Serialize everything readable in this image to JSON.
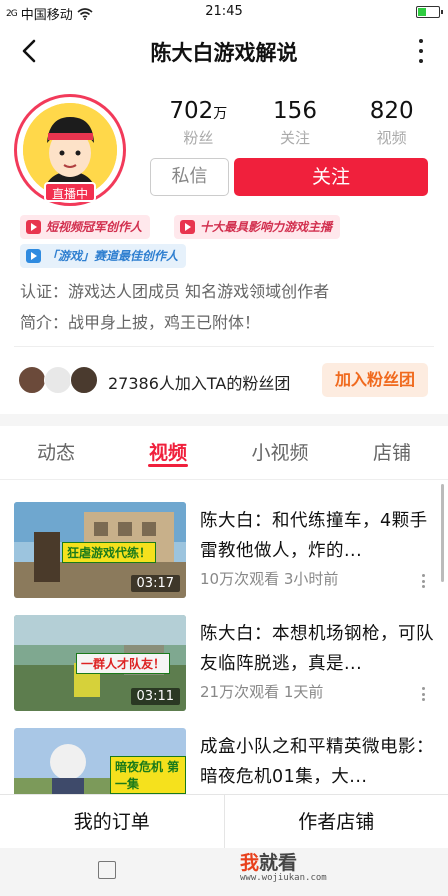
{
  "status_bar": {
    "signal": "2G",
    "carrier": "中国移动",
    "time": "21:45"
  },
  "nav": {
    "title": "陈大白游戏解说"
  },
  "profile": {
    "live_badge": "直播中",
    "stats": [
      {
        "value": "702",
        "unit": "万",
        "label": "粉丝"
      },
      {
        "value": "156",
        "unit": "",
        "label": "关注"
      },
      {
        "value": "820",
        "unit": "",
        "label": "视频"
      }
    ],
    "message_button": "私信",
    "follow_button": "关注",
    "tags": [
      "短视频冠军创作人",
      "十大最具影响力游戏主播",
      "「游戏」赛道最佳创作人"
    ],
    "certification": "认证：游戏达人团成员 知名游戏领域创作者",
    "bio": "简介：战甲身上披，鸡王已附体！"
  },
  "fan_club": {
    "text": "27386人加入TA的粉丝团",
    "join_button": "加入粉丝团"
  },
  "tabs": [
    {
      "label": "动态",
      "active": false
    },
    {
      "label": "视频",
      "active": true
    },
    {
      "label": "小视频",
      "active": false
    },
    {
      "label": "店铺",
      "active": false
    }
  ],
  "videos": [
    {
      "title": "陈大白：和代练撞车，4颗手雷教他做人，炸的...",
      "meta": "10万次观看 3小时前",
      "duration": "03:17",
      "thumb_caption": "狂虐游戏代练！"
    },
    {
      "title": "陈大白：本想机场钢枪，可队友临阵脱逃，真是...",
      "meta": "21万次观看 1天前",
      "duration": "03:11",
      "thumb_caption": "一群人才队友！"
    },
    {
      "title": "成盒小队之和平精英微电影：暗夜危机01集，大...",
      "meta": "",
      "duration": "",
      "thumb_caption": "暗夜危机 第一集"
    }
  ],
  "bottom_bar": {
    "orders": "我的订单",
    "shop": "作者店铺"
  },
  "watermark": {
    "main_red": "我",
    "main": "就看",
    "url": "www.wojiukan.com"
  },
  "colors": {
    "accent": "#f0203c",
    "fan_club": "#f06a1e"
  }
}
